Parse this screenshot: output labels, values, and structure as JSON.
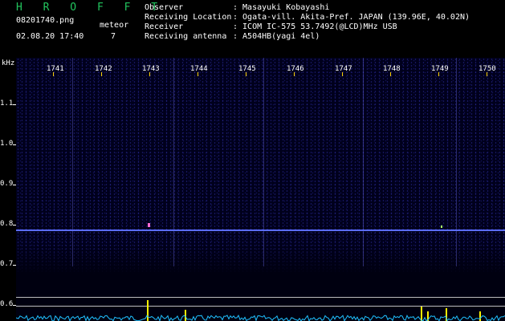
{
  "header": {
    "brand": "H R O F F T",
    "filename": "08201740.png",
    "datetime": "02.08.20 17:40",
    "meteor_label": "meteor",
    "meteor_count": "7"
  },
  "info": [
    {
      "key": "Observer",
      "value": ": Masayuki Kobayashi"
    },
    {
      "key": "Receiving Location",
      "value": ": Ogata-vill. Akita-Pref. JAPAN (139.96E, 40.02N)"
    },
    {
      "key": "Receiver",
      "value": ": ICOM IC-575 53.7492(@LCD)MHz USB"
    },
    {
      "key": "Receiving antenna",
      "value": ": A504HB(yagi 4el)"
    }
  ],
  "axis": {
    "y_unit": "kHz",
    "y_ticks": [
      "1.1",
      "1.0",
      "0.9",
      "0.8",
      "0.7",
      "0.6"
    ],
    "x_ticks": [
      "1741",
      "1742",
      "1743",
      "1744",
      "1745",
      "1746",
      "1747",
      "1748",
      "1749",
      "1750"
    ]
  },
  "colors": {
    "brand": "#22c55e",
    "background": "#000000",
    "spectrogram": "#00001c",
    "carrier_band": "#5a6cff",
    "meteor_spike": "#fff200",
    "level_trace": "#20c0ff"
  }
}
